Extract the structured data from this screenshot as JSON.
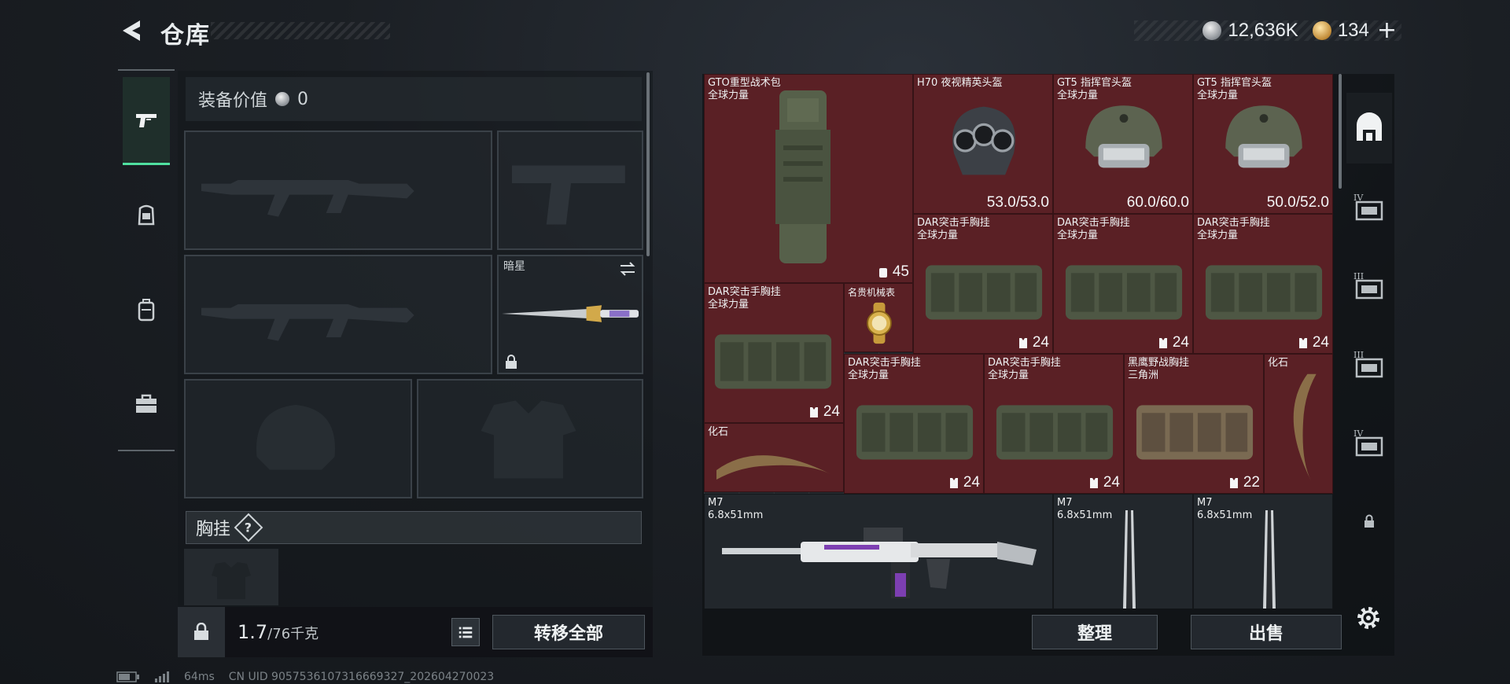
{
  "header": {
    "title": "仓库",
    "currency": [
      {
        "icon": "silver-coin-icon",
        "value": "12,636K"
      },
      {
        "icon": "gold-coin-icon",
        "value": "134"
      }
    ],
    "plus_label": "+"
  },
  "left_nav": {
    "items": [
      {
        "name": "weapons",
        "icon": "pistol-icon",
        "active": true
      },
      {
        "name": "helmet",
        "icon": "helmet-armor-icon",
        "active": false
      },
      {
        "name": "backpack",
        "icon": "backpack-icon",
        "active": false
      },
      {
        "name": "case",
        "icon": "briefcase-icon",
        "active": false
      }
    ]
  },
  "loadout": {
    "equip_value_label": "装备价值",
    "equip_value": "0",
    "melee_label": "暗星",
    "chest_rig_label": "胸挂",
    "help_label": "?",
    "weight_current": "1.7",
    "weight_max": "/76千克",
    "transfer_all_label": "转移全部"
  },
  "stash": {
    "items": [
      {
        "id": "gto-pack",
        "name": "GTO重型战术包",
        "sub": "全球力量",
        "stat": "45",
        "stat_icon": "backpack-mini-icon",
        "bg": "red"
      },
      {
        "id": "h70-helmet",
        "name": "H70 夜视精英头盔",
        "sub": "",
        "stat": "53.0/53.0",
        "stat_icon": "",
        "bg": "red"
      },
      {
        "id": "gt5-helmet-1",
        "name": "GT5 指挥官头盔",
        "sub": "全球力量",
        "stat": "60.0/60.0",
        "stat_icon": "",
        "bg": "red"
      },
      {
        "id": "gt5-helmet-2",
        "name": "GT5 指挥官头盔",
        "sub": "全球力量",
        "stat": "50.0/52.0",
        "stat_icon": "",
        "bg": "red"
      },
      {
        "id": "dar-rig-1",
        "name": "DAR突击手胸挂",
        "sub": "全球力量",
        "stat": "24",
        "stat_icon": "vest-mini-icon",
        "bg": "red"
      },
      {
        "id": "dar-rig-2",
        "name": "DAR突击手胸挂",
        "sub": "全球力量",
        "stat": "24",
        "stat_icon": "vest-mini-icon",
        "bg": "red"
      },
      {
        "id": "dar-rig-3",
        "name": "DAR突击手胸挂",
        "sub": "全球力量",
        "stat": "24",
        "stat_icon": "vest-mini-icon",
        "bg": "red"
      },
      {
        "id": "dar-rig-4",
        "name": "DAR突击手胸挂",
        "sub": "全球力量",
        "stat": "24",
        "stat_icon": "vest-mini-icon",
        "bg": "red"
      },
      {
        "id": "luxury-watch",
        "name": "名贵机械表",
        "sub": "",
        "stat": "",
        "stat_icon": "",
        "bg": "red"
      },
      {
        "id": "dar-rig-5",
        "name": "DAR突击手胸挂",
        "sub": "全球力量",
        "stat": "24",
        "stat_icon": "vest-mini-icon",
        "bg": "red"
      },
      {
        "id": "dar-rig-6",
        "name": "DAR突击手胸挂",
        "sub": "全球力量",
        "stat": "24",
        "stat_icon": "vest-mini-icon",
        "bg": "red"
      },
      {
        "id": "blackhawk-rig",
        "name": "黑鹰野战胸挂",
        "sub": "三角洲",
        "stat": "22",
        "stat_icon": "vest-mini-icon",
        "bg": "red"
      },
      {
        "id": "fossil-1",
        "name": "化石",
        "sub": "",
        "stat": "",
        "stat_icon": "",
        "bg": "red"
      },
      {
        "id": "fossil-2",
        "name": "化石",
        "sub": "",
        "stat": "",
        "stat_icon": "",
        "bg": "red"
      },
      {
        "id": "m7-rifle",
        "name": "M7",
        "sub": "6.8x51mm",
        "stat": "",
        "stat_icon": "",
        "bg": "dark"
      },
      {
        "id": "m7-mag-1",
        "name": "M7",
        "sub": "6.8x51mm",
        "stat": "",
        "stat_icon": "",
        "bg": "dark"
      },
      {
        "id": "m7-mag-2",
        "name": "M7",
        "sub": "6.8x51mm",
        "stat": "",
        "stat_icon": "",
        "bg": "dark"
      }
    ],
    "sort_label": "整理",
    "sell_label": "出售"
  },
  "right_nav": {
    "items": [
      {
        "name": "warehouse",
        "icon": "warehouse-icon",
        "label": ""
      },
      {
        "name": "tier-4-a",
        "icon": "container-icon",
        "label": "IV"
      },
      {
        "name": "tier-3-a",
        "icon": "container-icon",
        "label": "III"
      },
      {
        "name": "tier-3-b",
        "icon": "container-icon",
        "label": "III"
      },
      {
        "name": "tier-4-b",
        "icon": "container-icon",
        "label": "IV"
      },
      {
        "name": "locked",
        "icon": "lock-icon",
        "label": ""
      }
    ]
  },
  "status": {
    "ping": "64ms",
    "uid": "CN UID 9057536107316669327_202604270023"
  },
  "colors": {
    "accent_green": "#4fe0a0",
    "rare_red": "#5a2025",
    "panel_dark": "#1d2227"
  }
}
